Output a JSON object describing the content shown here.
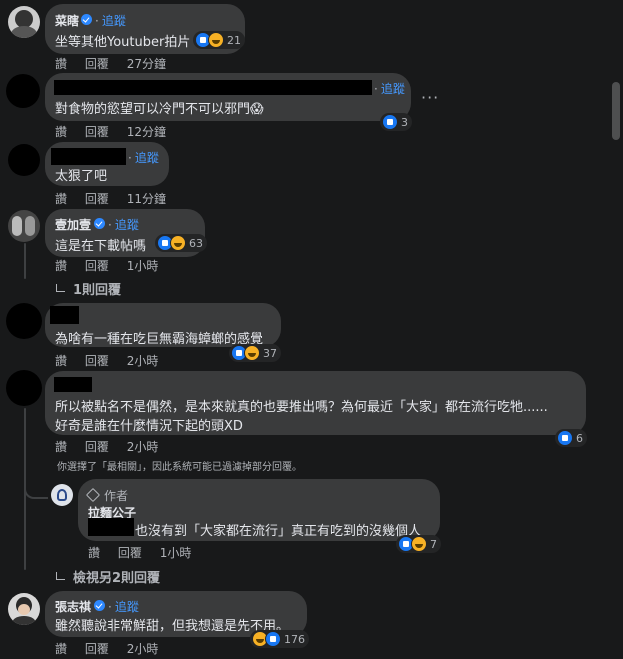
{
  "labels": {
    "follow": "追蹤",
    "like": "讚",
    "reply": "回覆",
    "author": "作者"
  },
  "comments": [
    {
      "name": "菜瞎",
      "verified": true,
      "text": "坐等其他Youtuber拍片",
      "time": "",
      "reactions": [
        "like",
        "haha"
      ],
      "count": "21"
    },
    {
      "name": "",
      "text": "對食物的慾望可以冷門不可以邪門😱",
      "time": "27分鐘",
      "reactions": [
        "like"
      ],
      "count": "3"
    },
    {
      "name": "",
      "text": "太狠了吧",
      "time": "12分鐘",
      "reactions": [],
      "count": ""
    },
    {
      "name": "壹加壹",
      "verified": true,
      "text": "這是在下載帖嗎",
      "time": "11分鐘",
      "reactions": [
        "like",
        "haha"
      ],
      "count": "63",
      "replies": "1則回覆"
    },
    {
      "name": "",
      "text": "為啥有一種在吃巨無霸海蟑螂的感覺",
      "time": "1小時",
      "reactions": [
        "like",
        "haha"
      ],
      "count": "37"
    },
    {
      "name": "",
      "text_line1": "所以被點名不是偶然，是本來就真的也要推出嗎？為何最近「大家」都在流行吃牠......",
      "text_line2": "好奇是誰在什麼情況下起的頭XD",
      "time": "2小時",
      "reactions": [
        "like"
      ],
      "count": "6",
      "notice": "你選擇了「最相關」，因此系統可能已過濾掉部分回覆。"
    },
    {
      "name": "拉麵公子",
      "author": true,
      "text": "也沒有到「大家都在流行」真正有吃到的沒幾個人",
      "time": "2小時",
      "reactions": [
        "like",
        "haha"
      ],
      "count": "7",
      "more_replies": "檢視另2則回覆"
    },
    {
      "name": "張志祺",
      "verified": true,
      "text": "雖然聽說非常鮮甜，但我想還是先不用。",
      "time": "1小時",
      "reactions": [
        "haha",
        "like"
      ],
      "count": "176"
    },
    {
      "time": "2小時"
    }
  ],
  "colors": {
    "background": "#18191a",
    "bubble": "#3a3b3c",
    "link": "#4599ff",
    "secondary_text": "#b0b3b8"
  }
}
